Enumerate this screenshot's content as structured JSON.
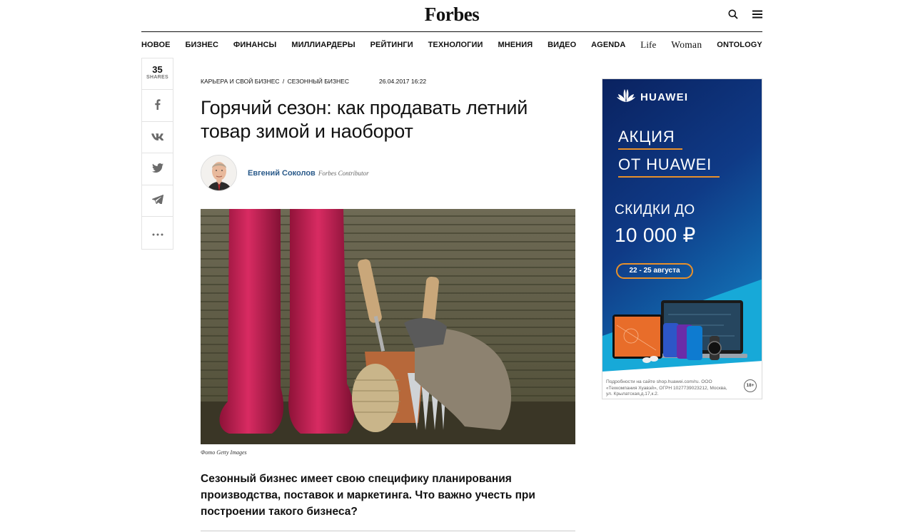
{
  "header": {
    "logo": "Forbes",
    "search_icon": "search-icon",
    "menu_icon": "hamburger-menu-icon"
  },
  "nav": {
    "items": [
      "НОВОЕ",
      "БИЗНЕС",
      "ФИНАНСЫ",
      "МИЛЛИАРДЕРЫ",
      "РЕЙТИНГИ",
      "ТЕХНОЛОГИИ",
      "МНЕНИЯ",
      "ВИДЕО",
      "AGENDA",
      "Life",
      "Woman",
      "ONTOLOGY"
    ]
  },
  "share": {
    "count": "35",
    "label": "SHARES",
    "buttons": [
      {
        "name": "facebook-icon",
        "glyph": "f"
      },
      {
        "name": "vk-icon",
        "glyph": "vk"
      },
      {
        "name": "twitter-icon",
        "glyph": "twitter"
      },
      {
        "name": "telegram-icon",
        "glyph": "telegram"
      },
      {
        "name": "more-icon",
        "glyph": "..."
      }
    ]
  },
  "article": {
    "breadcrumb": [
      "КАРЬЕРА И СВОЙ БИЗНЕС",
      "/",
      "СЕЗОННЫЙ БИЗНЕС"
    ],
    "date": "26.04.2017 16:22",
    "title": "Горячий сезон: как продавать летний товар зимой и наоборот",
    "author_name": "Евгений Соколов",
    "author_role": "Forbes Contributor",
    "photo_caption": "Фото Getty Images",
    "lead": "Сезонный бизнес имеет свою специфику планирования производства, поставок и маркетинга. Что важно учесть при построении такого бизнеса?"
  },
  "ad": {
    "brand": "HUAWEI",
    "headline_1": "АКЦИЯ",
    "headline_2": "ОТ HUAWEI",
    "discount_1": "СКИДКИ ДО",
    "discount_2": "10 000 ₽",
    "dates": "22 - 25 августа",
    "fine_print": "Подробности на сайте shop.huawei.com/ru. ООО «Техкомпания Хуавэй», ОГРН 1027739023212, Москва, ул. Крылатская,д.17,к.2.",
    "age": "18+",
    "colors": {
      "navy": "#0b2466",
      "teal": "#1296c8",
      "orange": "#e8902a"
    }
  }
}
